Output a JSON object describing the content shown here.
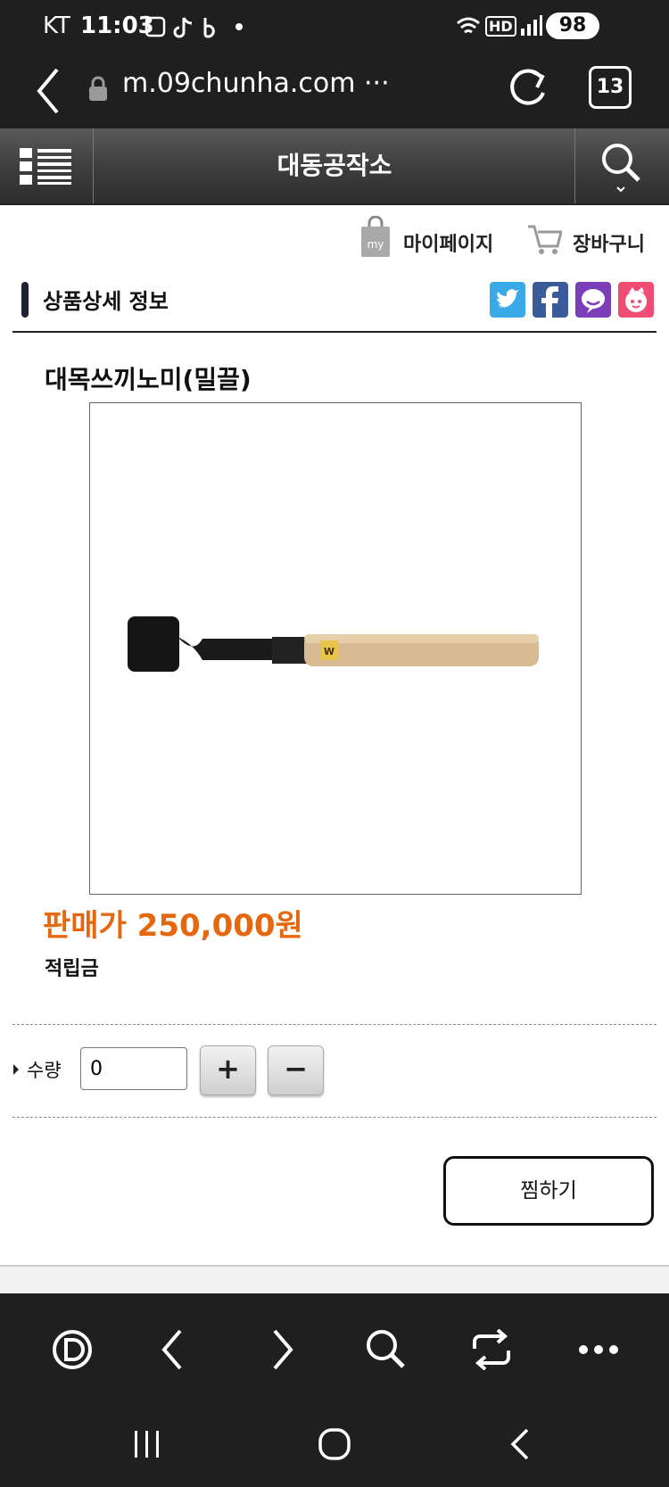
{
  "status_bar": {
    "carrier": "KT",
    "time": "11:03",
    "network": "HD",
    "battery": "98"
  },
  "browser": {
    "url": "m.09chunha.com ···",
    "tab_count": "13"
  },
  "site": {
    "title": "대동공작소",
    "mypage_label": "마이페이지",
    "cart_label": "장바구니",
    "mypage_badge": "my"
  },
  "section": {
    "title": "상품상세 정보"
  },
  "product": {
    "name": "대목쓰끼노미(밀끌)",
    "price": "판매가 250,000원",
    "points_label": "적립금",
    "handle_mark": "W"
  },
  "quantity": {
    "label": "수량",
    "value": "0",
    "plus": "+",
    "minus": "−"
  },
  "wish": {
    "label": "찜하기"
  },
  "colors": {
    "price": "#e5670e",
    "bar": "#1f1f1f",
    "twitter": "#3aa9e8",
    "facebook": "#3b5a9a",
    "kakao": "#7a3fb8",
    "other": "#ef4e72"
  }
}
